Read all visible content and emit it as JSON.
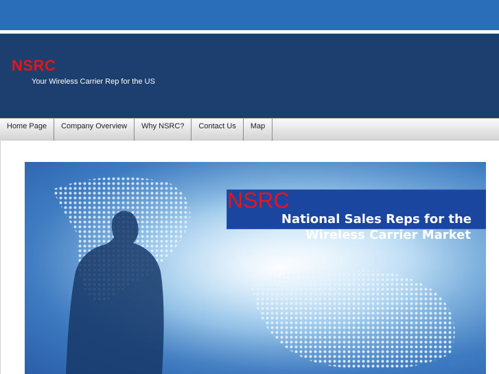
{
  "header": {
    "brand": "NSRC",
    "tagline": "Your Wireless Carrier Rep for the US"
  },
  "nav": {
    "items": [
      {
        "label": "Home Page"
      },
      {
        "label": "Company Overview"
      },
      {
        "label": "Why NSRC?"
      },
      {
        "label": "Contact Us"
      },
      {
        "label": "Map"
      }
    ]
  },
  "banner": {
    "brand": "NSRC",
    "line1": "National Sales Reps for the",
    "line2": "Wireless Carrier Market"
  },
  "colors": {
    "top_bar": "#2a6db8",
    "header_bg": "#1c3f6f",
    "brand_red": "#e8141a",
    "banner_box": "#1b46a0"
  }
}
